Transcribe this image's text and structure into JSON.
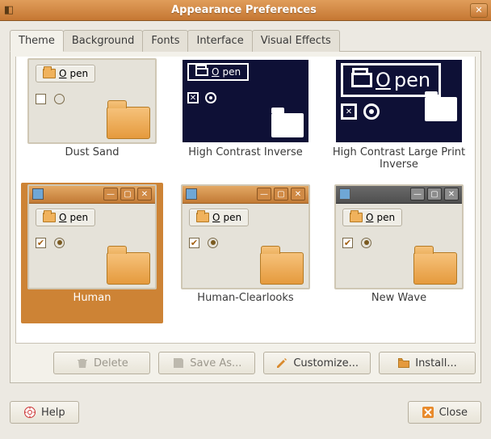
{
  "window": {
    "title": "Appearance Preferences"
  },
  "tabs": {
    "items": [
      {
        "label": "Theme",
        "active": true
      },
      {
        "label": "Background"
      },
      {
        "label": "Fonts"
      },
      {
        "label": "Interface"
      },
      {
        "label": "Visual Effects"
      }
    ]
  },
  "themes": {
    "open_label": "Open",
    "items": [
      {
        "name": "Dust Sand",
        "kind": "light",
        "titlebar": "gray",
        "cutTop": true,
        "selected": false
      },
      {
        "name": "High Contrast Inverse",
        "kind": "dark",
        "cutTop": true,
        "large": false,
        "selected": false
      },
      {
        "name": "High Contrast Large Print Inverse",
        "kind": "dark",
        "cutTop": true,
        "large": true,
        "selected": false
      },
      {
        "name": "Human",
        "kind": "light",
        "titlebar": "orange",
        "cutTop": false,
        "selected": true
      },
      {
        "name": "Human-Clearlooks",
        "kind": "light",
        "titlebar": "orange",
        "cutTop": false,
        "selected": false
      },
      {
        "name": "New Wave",
        "kind": "light",
        "titlebar": "gray",
        "cutTop": false,
        "selected": false
      }
    ]
  },
  "buttons": {
    "delete": "Delete",
    "save_as": "Save As...",
    "customize": "Customize...",
    "install": "Install...",
    "delete_enabled": false,
    "save_as_enabled": false,
    "customize_enabled": true,
    "install_enabled": true
  },
  "footer": {
    "help": "Help",
    "close": "Close"
  },
  "colors": {
    "accent": "#c57733",
    "selection": "#cd8335"
  }
}
